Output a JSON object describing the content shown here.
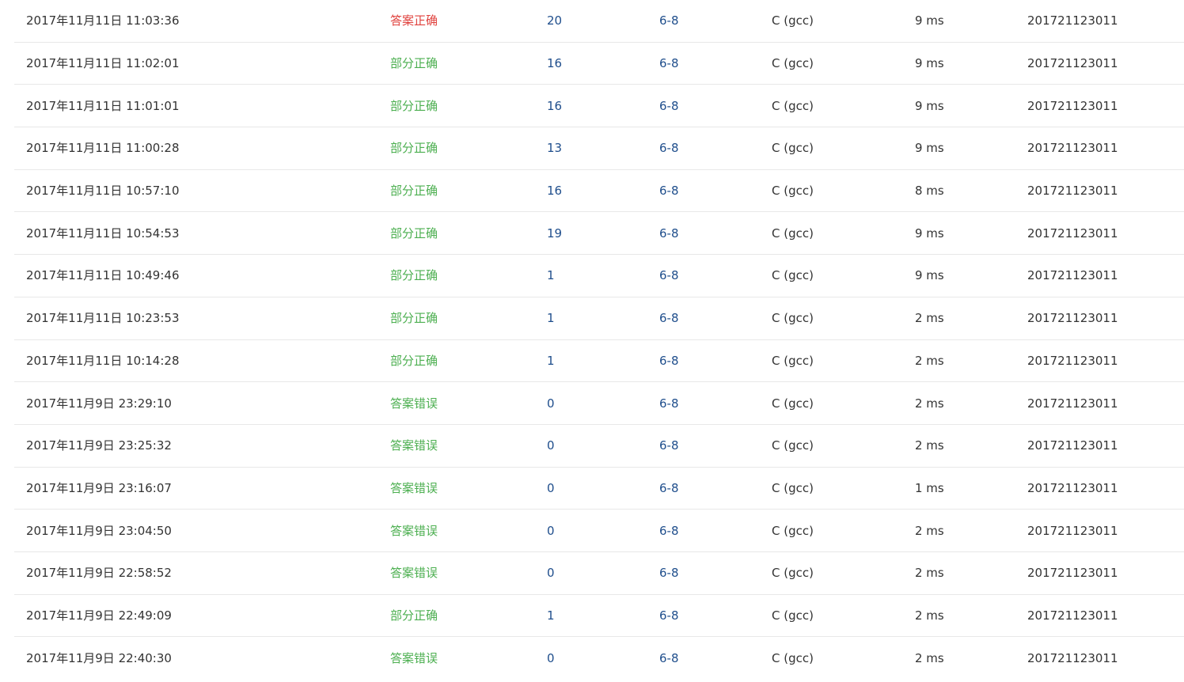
{
  "colors": {
    "accepted": "#e0413d",
    "partial": "#4caf50",
    "wrong": "#4caf50",
    "link": "#1f4e8c",
    "text": "#333333",
    "divider": "#e8e8e8"
  },
  "submissions": [
    {
      "time": "2017年11月11日 11:03:36",
      "status": "答案正确",
      "status_type": "accepted",
      "score": "20",
      "problem": "6-8",
      "language": "C (gcc)",
      "memory": "9 ms",
      "user": "201721123011"
    },
    {
      "time": "2017年11月11日 11:02:01",
      "status": "部分正确",
      "status_type": "partial",
      "score": "16",
      "problem": "6-8",
      "language": "C (gcc)",
      "memory": "9 ms",
      "user": "201721123011"
    },
    {
      "time": "2017年11月11日 11:01:01",
      "status": "部分正确",
      "status_type": "partial",
      "score": "16",
      "problem": "6-8",
      "language": "C (gcc)",
      "memory": "9 ms",
      "user": "201721123011"
    },
    {
      "time": "2017年11月11日 11:00:28",
      "status": "部分正确",
      "status_type": "partial",
      "score": "13",
      "problem": "6-8",
      "language": "C (gcc)",
      "memory": "9 ms",
      "user": "201721123011"
    },
    {
      "time": "2017年11月11日 10:57:10",
      "status": "部分正确",
      "status_type": "partial",
      "score": "16",
      "problem": "6-8",
      "language": "C (gcc)",
      "memory": "8 ms",
      "user": "201721123011"
    },
    {
      "time": "2017年11月11日 10:54:53",
      "status": "部分正确",
      "status_type": "partial",
      "score": "19",
      "problem": "6-8",
      "language": "C (gcc)",
      "memory": "9 ms",
      "user": "201721123011"
    },
    {
      "time": "2017年11月11日 10:49:46",
      "status": "部分正确",
      "status_type": "partial",
      "score": "1",
      "problem": "6-8",
      "language": "C (gcc)",
      "memory": "9 ms",
      "user": "201721123011"
    },
    {
      "time": "2017年11月11日 10:23:53",
      "status": "部分正确",
      "status_type": "partial",
      "score": "1",
      "problem": "6-8",
      "language": "C (gcc)",
      "memory": "2 ms",
      "user": "201721123011"
    },
    {
      "time": "2017年11月11日 10:14:28",
      "status": "部分正确",
      "status_type": "partial",
      "score": "1",
      "problem": "6-8",
      "language": "C (gcc)",
      "memory": "2 ms",
      "user": "201721123011"
    },
    {
      "time": "2017年11月9日 23:29:10",
      "status": "答案错误",
      "status_type": "wrong",
      "score": "0",
      "problem": "6-8",
      "language": "C (gcc)",
      "memory": "2 ms",
      "user": "201721123011"
    },
    {
      "time": "2017年11月9日 23:25:32",
      "status": "答案错误",
      "status_type": "wrong",
      "score": "0",
      "problem": "6-8",
      "language": "C (gcc)",
      "memory": "2 ms",
      "user": "201721123011"
    },
    {
      "time": "2017年11月9日 23:16:07",
      "status": "答案错误",
      "status_type": "wrong",
      "score": "0",
      "problem": "6-8",
      "language": "C (gcc)",
      "memory": "1 ms",
      "user": "201721123011"
    },
    {
      "time": "2017年11月9日 23:04:50",
      "status": "答案错误",
      "status_type": "wrong",
      "score": "0",
      "problem": "6-8",
      "language": "C (gcc)",
      "memory": "2 ms",
      "user": "201721123011"
    },
    {
      "time": "2017年11月9日 22:58:52",
      "status": "答案错误",
      "status_type": "wrong",
      "score": "0",
      "problem": "6-8",
      "language": "C (gcc)",
      "memory": "2 ms",
      "user": "201721123011"
    },
    {
      "time": "2017年11月9日 22:49:09",
      "status": "部分正确",
      "status_type": "partial",
      "score": "1",
      "problem": "6-8",
      "language": "C (gcc)",
      "memory": "2 ms",
      "user": "201721123011"
    },
    {
      "time": "2017年11月9日 22:40:30",
      "status": "答案错误",
      "status_type": "wrong",
      "score": "0",
      "problem": "6-8",
      "language": "C (gcc)",
      "memory": "2 ms",
      "user": "201721123011"
    }
  ]
}
